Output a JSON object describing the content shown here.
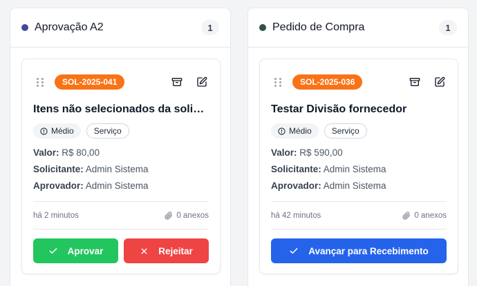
{
  "columns": [
    {
      "title": "Aprovação A2",
      "dot_color": "#3f4a9e",
      "count": "1",
      "card": {
        "code": "SOL-2025-041",
        "code_color": "#f97316",
        "title": "Itens não selecionados da solicit...",
        "priority": "Médio",
        "type": "Serviço",
        "valor_label": "Valor:",
        "valor": "R$ 80,00",
        "solicitante_label": "Solicitante:",
        "solicitante": "Admin Sistema",
        "aprovador_label": "Aprovador:",
        "aprovador": "Admin Sistema",
        "time": "há 2 minutos",
        "attachments": "0 anexos",
        "approve_label": "Aprovar",
        "reject_label": "Rejeitar"
      }
    },
    {
      "title": "Pedido de Compra",
      "dot_color": "#2f5249",
      "count": "1",
      "card": {
        "code": "SOL-2025-036",
        "code_color": "#f97316",
        "title": "Testar Divisão fornecedor",
        "priority": "Médio",
        "type": "Serviço",
        "valor_label": "Valor:",
        "valor": "R$ 590,00",
        "solicitante_label": "Solicitante:",
        "solicitante": "Admin Sistema",
        "aprovador_label": "Aprovador:",
        "aprovador": "Admin Sistema",
        "time": "há 42 minutos",
        "attachments": "0 anexos",
        "advance_label": "Avançar para Recebimento"
      }
    }
  ],
  "icons": {
    "drag": "grip-vertical-icon",
    "archive": "archive-icon",
    "edit": "edit-icon",
    "priority": "alert-circle-icon",
    "attachment": "paperclip-icon",
    "approve": "check-icon",
    "reject": "x-icon",
    "advance": "check-icon"
  },
  "colors": {
    "approve": "#22c55e",
    "reject": "#ef4444",
    "advance": "#2563eb"
  }
}
